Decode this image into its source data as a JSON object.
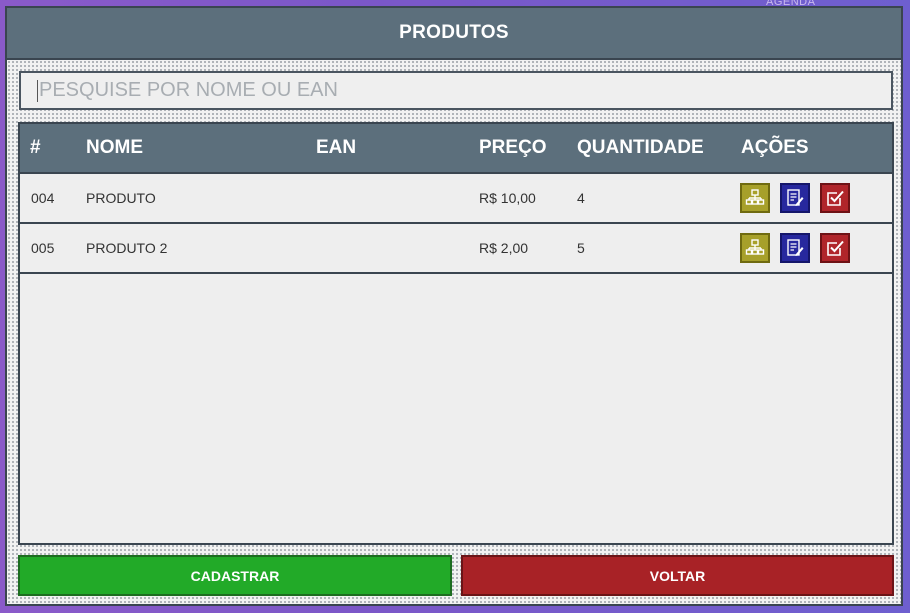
{
  "background": {
    "label": "AGENDA"
  },
  "window": {
    "title": "PRODUTOS"
  },
  "search": {
    "placeholder": "PESQUISE POR NOME OU EAN",
    "value": ""
  },
  "table": {
    "headers": {
      "id": "#",
      "name": "NOME",
      "ean": "EAN",
      "price": "PREÇO",
      "quantity": "QUANTIDADE",
      "actions": "AÇÕES"
    },
    "rows": [
      {
        "id": "004",
        "name": "PRODUTO",
        "ean": "",
        "price": "R$ 10,00",
        "quantity": "4",
        "actions": [
          "structure-icon",
          "edit-document-icon",
          "checkbox-check-icon"
        ]
      },
      {
        "id": "005",
        "name": "PRODUTO 2",
        "ean": "",
        "price": "R$ 2,00",
        "quantity": "5",
        "actions": [
          "structure-icon",
          "edit-document-icon",
          "checkbox-check-icon"
        ]
      }
    ]
  },
  "buttons": {
    "register": "CADASTRAR",
    "back": "VOLTAR"
  },
  "colors": {
    "header": "#5c6f7c",
    "register": "#22aa28",
    "back": "#a82226",
    "action_structure": "#a7a02a",
    "action_edit": "#27289e",
    "action_check": "#b0252a"
  }
}
